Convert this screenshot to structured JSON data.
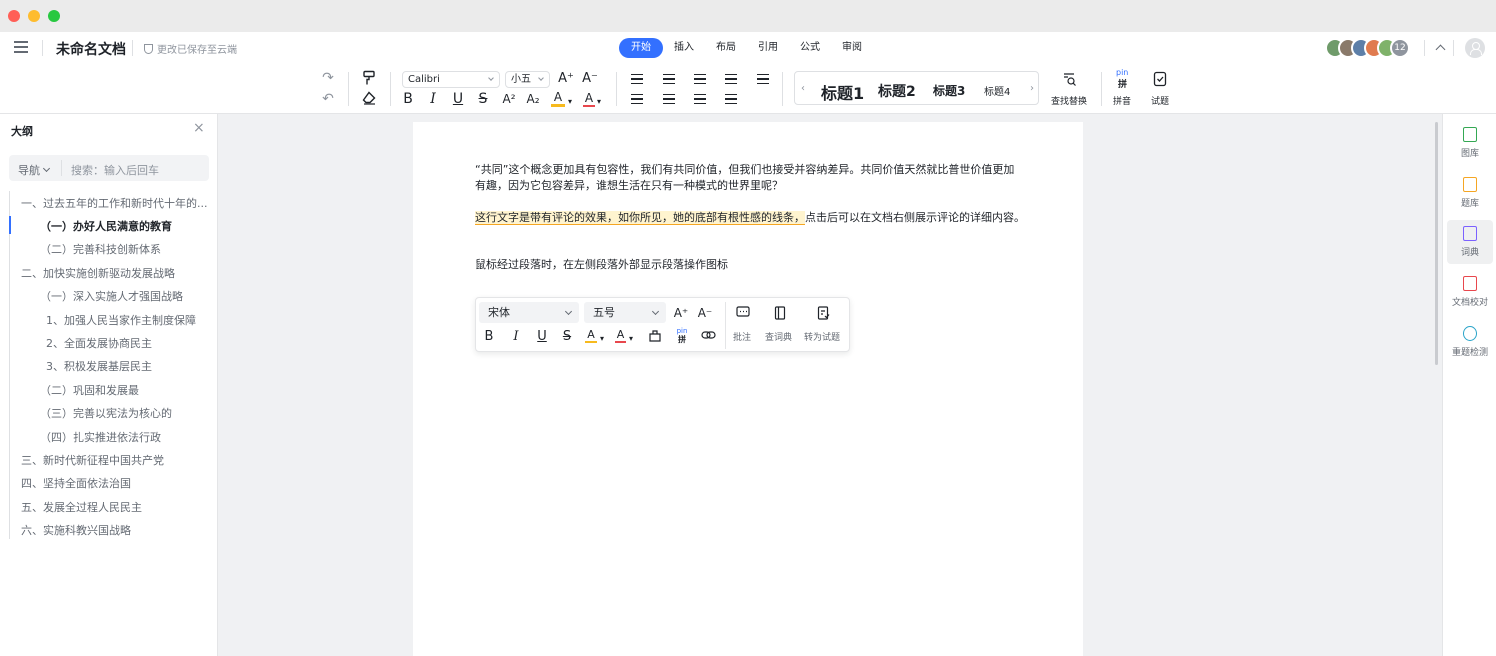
{
  "app": {
    "doc_title": "未命名文档",
    "save_status": "更改已保存至云端",
    "tabs": [
      {
        "label": "开始",
        "active": true
      },
      {
        "label": "插入"
      },
      {
        "label": "布局"
      },
      {
        "label": "引用"
      },
      {
        "label": "公式"
      },
      {
        "label": "审阅"
      }
    ],
    "collaborator_count": "12",
    "avatar_colors": [
      "#6f9b6a",
      "#8a7a6a",
      "#5d7fa8",
      "#e07b4f",
      "#7fb26a"
    ]
  },
  "toolbar": {
    "undo": "↶",
    "redo": "↷",
    "format_painter": "format-painter-icon",
    "clear_format": "eraser-icon",
    "font_family": "Calibri",
    "font_size": "小五",
    "grow_font": "A⁺",
    "shrink_font": "A⁻",
    "bold": "B",
    "italic": "I",
    "underline": "U",
    "strikethrough": "S",
    "superscript": "A²",
    "subscript": "A₂",
    "highlight": "A",
    "font_color": "A",
    "headings": [
      "标题1",
      "标题2",
      "标题3",
      "标题4"
    ],
    "find_replace": "查找替换",
    "pinyin_top": "pin",
    "pinyin_mid": "拼",
    "pinyin": "拼音",
    "quiz": "试题"
  },
  "sidebar": {
    "title": "大纲",
    "close": "×",
    "nav_label": "导航",
    "search_placeholder": "搜索：输入后回车",
    "outline": [
      {
        "label": "一、过去五年的工作和新时代十年的...",
        "level": 1
      },
      {
        "label": "（一）办好人民满意的教育",
        "level": 2,
        "active": true
      },
      {
        "label": "（二）完善科技创新体系",
        "level": 2
      },
      {
        "label": "二、加快实施创新驱动发展战略",
        "level": 1
      },
      {
        "label": "（一）深入实施人才强国战略",
        "level": 2
      },
      {
        "label": "1、加强人民当家作主制度保障",
        "level": 3
      },
      {
        "label": "2、全面发展协商民主",
        "level": 3
      },
      {
        "label": "3、积极发展基层民主",
        "level": 3
      },
      {
        "label": "（二）巩固和发展最",
        "level": 2
      },
      {
        "label": "（三）完善以宪法为核心的",
        "level": 2
      },
      {
        "label": "（四）扎实推进依法行政",
        "level": 2
      },
      {
        "label": "三、新时代新征程中国共产党",
        "level": 1
      },
      {
        "label": "四、坚持全面依法治国",
        "level": 1
      },
      {
        "label": "五、发展全过程人民民主",
        "level": 1
      },
      {
        "label": "六、实施科教兴国战略",
        "level": 1
      }
    ]
  },
  "document": {
    "para1_line1": "“共同”这个概念更加具有包容性，我们有共同价值，但我们也接受并容纳差异。共同价值天然就比普世价值更加",
    "para1_line2": "有趣，因为它包容差异，谁想生活在只有一种模式的世界里呢？",
    "para2_highlight": "这行文字是带有评论的效果，如你所见，她的底部有根性感的线条，",
    "para2_rest": "点击后可以在文档右侧展示评论的详细内容。",
    "para3": "鼠标经过段落时，在左侧段落外部显示段落操作图标"
  },
  "floating_toolbar": {
    "font_family": "宋体",
    "font_size": "五号",
    "grow_font": "A⁺",
    "shrink_font": "A⁻",
    "bold": "B",
    "italic": "I",
    "underline": "U",
    "strikethrough": "S",
    "highlight": "A",
    "font_color": "A",
    "pinyin_top": "pin",
    "pinyin_mid": "拼",
    "comment": "批注",
    "dictionary": "查词典",
    "to_quiz": "转为试题"
  },
  "right_rail": [
    {
      "label": "图库",
      "color": "#34a853"
    },
    {
      "label": "题库",
      "color": "#f5a623"
    },
    {
      "label": "词典",
      "color": "#7b61ff",
      "active": true
    },
    {
      "label": "文档校对",
      "color": "#e8474d"
    },
    {
      "label": "重题检测",
      "color": "#2aa4c9"
    }
  ],
  "colors": {
    "accent": "#3370ff",
    "highlight_bg": "#fff4cf",
    "highlight_line": "#f5a623",
    "font_color_underline": "#e8474d",
    "highlight_marker": "#f7ba1e"
  }
}
